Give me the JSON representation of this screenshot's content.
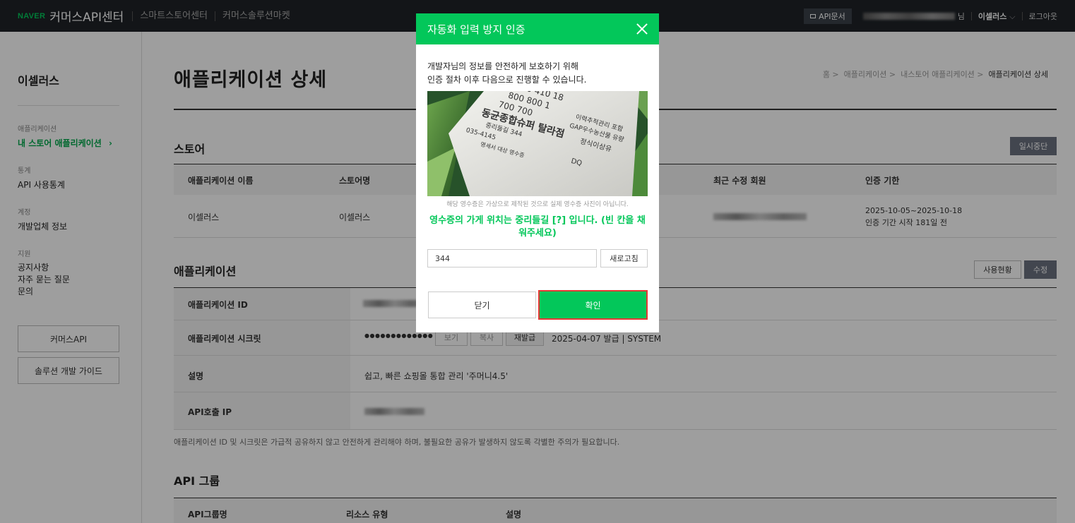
{
  "header": {
    "brand_naver": "NAVER",
    "brand_title": "커머스API센터",
    "links": [
      "스마트스토어센터",
      "커머스솔루션마켓"
    ],
    "api_doc": "API문서",
    "user_suffix": "님",
    "store_name": "이셀러스",
    "logout": "로그아웃"
  },
  "sidebar": {
    "title": "이셀러스",
    "groups": [
      {
        "category": "애플리케이션",
        "items": [
          {
            "label": "내 스토어 애플리케이션",
            "active": true
          }
        ]
      },
      {
        "category": "통계",
        "items": [
          {
            "label": "API 사용통계"
          }
        ]
      },
      {
        "category": "계정",
        "items": [
          {
            "label": "개발업체 정보"
          }
        ]
      },
      {
        "category": "지원",
        "items": [
          {
            "label": "공지사항"
          },
          {
            "label": "자주 묻는 질문"
          },
          {
            "label": "문의"
          }
        ]
      }
    ],
    "buttons": [
      "커머스API",
      "솔루션 개발 가이드"
    ]
  },
  "main": {
    "title": "애플리케이션 상세",
    "breadcrumb": [
      "홈",
      "애플리케이션",
      "내스토어 애플리케이션",
      "애플리케이션 상세"
    ],
    "store_section": {
      "title": "스토어",
      "pause_button": "일시중단",
      "columns": [
        "애플리케이션 이름",
        "스토어명",
        "최근 수정 회원",
        "인증 기한"
      ],
      "row": {
        "app_name": "이셀러스",
        "store_name": "이셀러스",
        "period": "2025-10-05~2025-10-18",
        "period_note": "인증 기간 시작 181일 전"
      }
    },
    "app_section": {
      "title": "애플리케이션",
      "usage_button": "사용현황",
      "edit_button": "수정",
      "rows": [
        {
          "label": "애플리케이션 ID"
        },
        {
          "label": "애플리케이션 시크릿",
          "secret_mask": "●●●●●●●●●●●●●",
          "view": "보기",
          "copy": "복사",
          "reissue": "재발급",
          "issued": "2025-04-07 발급 | SYSTEM"
        },
        {
          "label": "설명",
          "value": "쉽고, 빠른 쇼핑몰 통합 관리 '주머니4.5'"
        },
        {
          "label": "API호출 IP"
        }
      ],
      "note": "애플리케이션 ID 및 시크릿은 가급적 공유하지 않고 안전하게 관리해야 하며, 불필요한 공유가 발생하지 않도록 각별한 주의가 필요합니다."
    },
    "api_group_section": {
      "title": "API 그룹",
      "columns": [
        "API그룹명",
        "리소스 유형",
        "설명"
      ]
    }
  },
  "modal": {
    "title": "자동화 입력 방지 인증",
    "desc_line1": "개발자님의 정보를 안전하게 보호하기 위해",
    "desc_line2": "인증 절차 이후 다음으로 진행할 수 있습니다.",
    "caption": "해당 영수증은 가상으로 제작된 것으로 실제 영수증 사진이 아닙니다.",
    "question": "영수증의 가게 위치는 중리들길 [?] 입니다. (빈 칸을 채워주세요)",
    "answer": "344",
    "refresh": "새로고침",
    "close": "닫기",
    "confirm": "확인",
    "receipt_text": {
      "nums1": "7380  410  18",
      "nums2": "800   800  1",
      "nums3": "700   700",
      "line1": "이력추적관리 포함",
      "line2": "GAP우수농산물 유량",
      "store": "동균종합슈퍼 탈라점",
      "addr": "중리들길 344",
      "phone": "035-4145",
      "line3": "정식이상유",
      "line4": "명세서 대상 영수증",
      "code": "DQ"
    }
  },
  "colors": {
    "green": "#03c75a",
    "topbar": "#1f2328",
    "highlight": "#e53935"
  }
}
